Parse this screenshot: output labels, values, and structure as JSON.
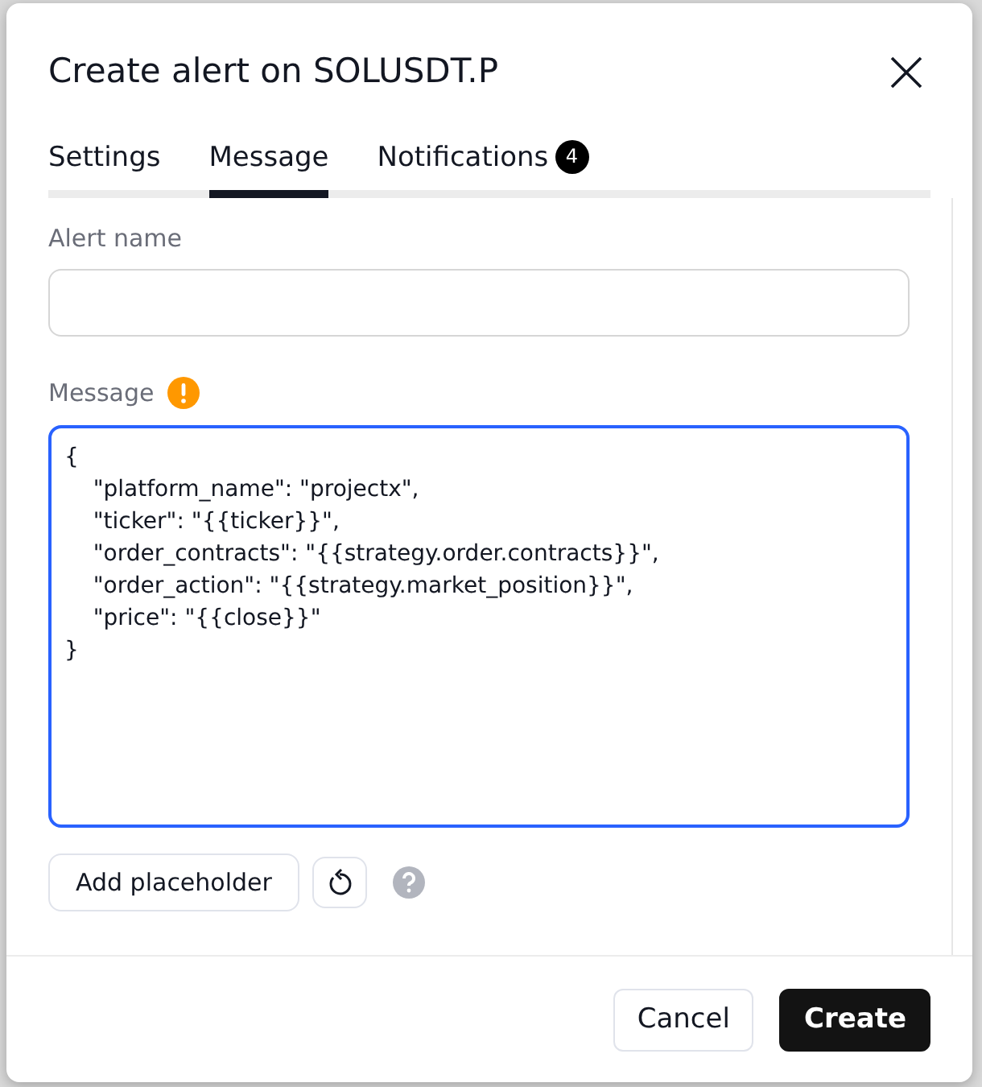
{
  "dialog": {
    "title": "Create alert on SOLUSDT.P"
  },
  "tabs": [
    {
      "label": "Settings",
      "selected": false
    },
    {
      "label": "Message",
      "selected": true
    },
    {
      "label": "Notifications",
      "selected": false,
      "badge": "4"
    }
  ],
  "alert_name": {
    "label": "Alert name"
  },
  "message": {
    "label": "Message",
    "warning": true,
    "value": "{\n    \"platform_name\": \"projectx\",\n    \"ticker\": \"{{ticker}}\",\n    \"order_contracts\": \"{{strategy.order.contracts}}\",\n    \"order_action\": \"{{strategy.market_position}}\",\n    \"price\": \"{{close}}\"\n}"
  },
  "add_placeholder": "Add placeholder",
  "buttons": [
    {
      "label": "Cancel",
      "kind": "secondary"
    },
    {
      "label": "Create",
      "kind": "primary"
    }
  ]
}
